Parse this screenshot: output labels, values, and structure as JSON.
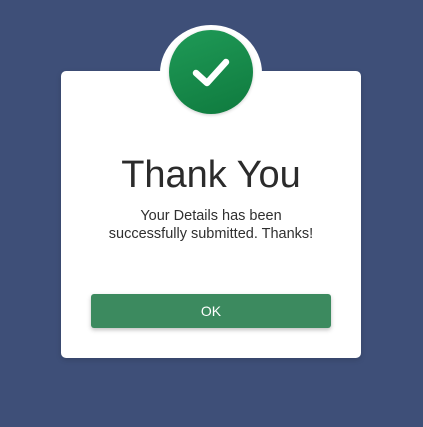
{
  "colors": {
    "background": "#3e4f78",
    "success_green": "#1f9a57",
    "success_green_dark": "#0f7a3e",
    "button_green": "#3c8a5f",
    "card": "#ffffff"
  },
  "dialog": {
    "icon": "checkmark-icon",
    "title": "Thank You",
    "message_line1": "Your Details has been",
    "message_line2": "successfully submitted. Thanks!",
    "ok_label": "OK"
  }
}
